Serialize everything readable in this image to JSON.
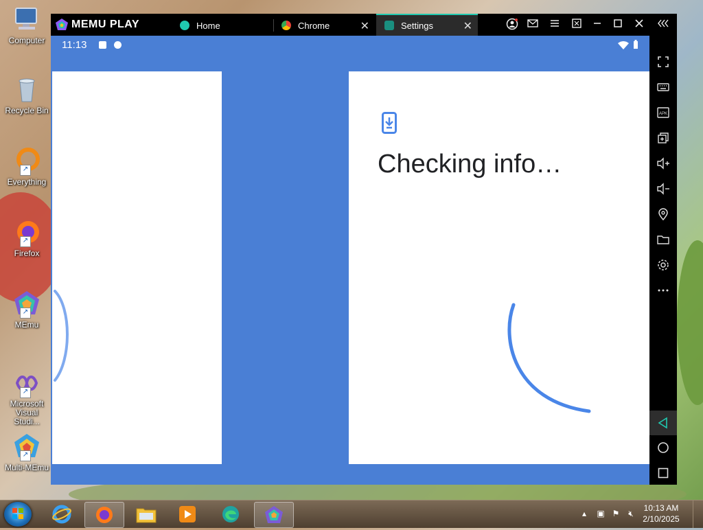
{
  "desktop": {
    "icons": [
      {
        "label": "Computer",
        "icon": "computer-icon"
      },
      {
        "label": "Recycle Bin",
        "icon": "recycle-bin-icon"
      },
      {
        "label": "Everything",
        "icon": "everything-search-icon"
      },
      {
        "label": "Firefox",
        "icon": "firefox-icon"
      },
      {
        "label": "MEmu",
        "icon": "memu-icon"
      },
      {
        "label": "Microsoft Visual Studi...",
        "icon": "visual-studio-icon"
      },
      {
        "label": "Multi-MEmu",
        "icon": "multi-memu-icon"
      }
    ]
  },
  "window": {
    "brand": "MEMU PLAY",
    "tabs": [
      {
        "label": "Home",
        "icon": "memu-home-icon",
        "active": false,
        "closable": false
      },
      {
        "label": "Chrome",
        "icon": "chrome-icon",
        "active": false,
        "closable": true
      },
      {
        "label": "Settings",
        "icon": "settings-icon",
        "active": true,
        "closable": true
      }
    ],
    "controls": [
      "account-icon",
      "mail-icon",
      "menu-icon",
      "screen-mode-icon",
      "minimize-icon",
      "maximize-icon",
      "close-icon",
      "collapse-toolbar-icon"
    ],
    "accent": "#20c9b0"
  },
  "android": {
    "status": {
      "time": "11:13"
    },
    "screen_title": "Checking info…",
    "background_color": "#4a7fd5",
    "spinner_color": "#4a86e8"
  },
  "toolbar": {
    "buttons": [
      "fullscreen-icon",
      "keyboard-icon",
      "apk-icon",
      "multi-window-icon",
      "volume-up-icon",
      "volume-down-icon",
      "location-icon",
      "folder-icon",
      "settings-gear-icon",
      "more-icon"
    ],
    "nav": [
      "back-icon",
      "home-icon",
      "recents-icon"
    ],
    "apk_label": "APK"
  },
  "taskbar": {
    "apps": [
      "internet-explorer-icon",
      "firefox-icon",
      "file-explorer-icon",
      "media-player-icon",
      "edge-icon",
      "memu-icon"
    ],
    "time": "10:13 AM",
    "date": "2/10/2025"
  }
}
